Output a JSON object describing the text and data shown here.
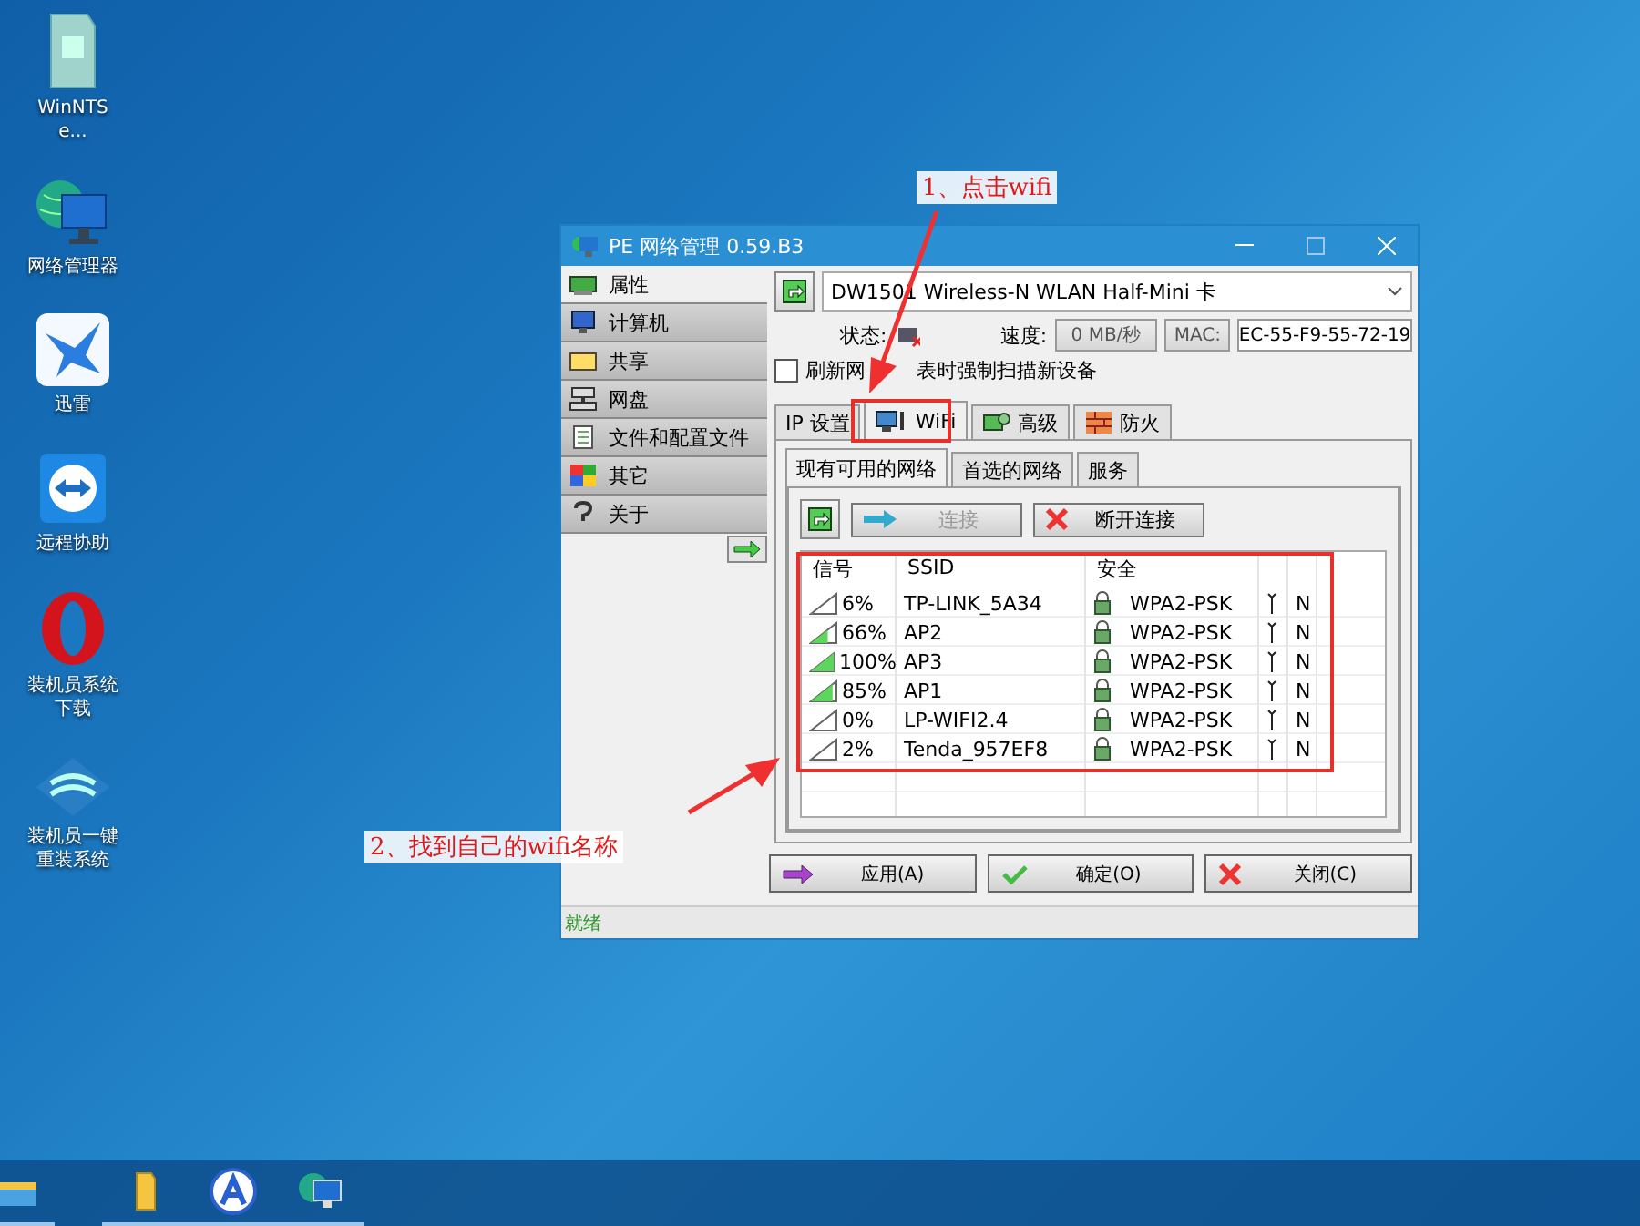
{
  "desktop_icons": [
    {
      "label": "WinNTSe..."
    },
    {
      "label": "网络管理器"
    },
    {
      "label": "迅雷"
    },
    {
      "label": "远程协助"
    },
    {
      "label": "装机员系统下载"
    },
    {
      "label": "装机员一键重装系统"
    }
  ],
  "window": {
    "title": "PE 网络管理 0.59.B3"
  },
  "sidebar": {
    "items": [
      {
        "label": "属性",
        "selected": true
      },
      {
        "label": "计算机",
        "selected": false
      },
      {
        "label": "共享",
        "selected": false
      },
      {
        "label": "网盘",
        "selected": false
      },
      {
        "label": "文件和配置文件",
        "selected": false
      },
      {
        "label": "其它",
        "selected": false
      },
      {
        "label": "关于",
        "selected": false
      }
    ]
  },
  "adapter": {
    "value": "DW1501 Wireless-N WLAN Half-Mini 卡"
  },
  "status": {
    "state_label": "状态:",
    "speed_label": "速度:",
    "speed": "0 MB/秒",
    "mac_label": "MAC:",
    "mac": "EC-55-F9-55-72-19"
  },
  "force_scan": {
    "label_parts": [
      "刷新网",
      "表时强制扫描新设备"
    ],
    "checked": false
  },
  "tabs": [
    {
      "label": "IP 设置",
      "selected": false
    },
    {
      "label": "WiFi",
      "selected": true
    },
    {
      "label": "高级",
      "selected": false
    },
    {
      "label": "防火",
      "selected": false
    }
  ],
  "subtabs": [
    {
      "label": "现有可用的网络",
      "selected": true
    },
    {
      "label": "首选的网络",
      "selected": false
    },
    {
      "label": "服务",
      "selected": false
    }
  ],
  "actions": [
    {
      "label": "连接",
      "disabled": true
    },
    {
      "label": "断开连接",
      "disabled": false
    }
  ],
  "table": {
    "columns": [
      "信号",
      "SSID",
      "安全"
    ],
    "rows": [
      {
        "level": 0.06,
        "signal": "6%",
        "ssid": "TP-LINK_5A34",
        "security": "WPA2-PSK",
        "mode": "N"
      },
      {
        "level": 0.66,
        "signal": "66%",
        "ssid": "AP2",
        "security": "WPA2-PSK",
        "mode": "N"
      },
      {
        "level": 1,
        "signal": "100%",
        "ssid": "AP3",
        "security": "WPA2-PSK",
        "mode": "N"
      },
      {
        "level": 0.85,
        "signal": "85%",
        "ssid": "AP1",
        "security": "WPA2-PSK",
        "mode": "N"
      },
      {
        "level": 0,
        "signal": "0%",
        "ssid": "LP-WIFI2.4",
        "security": "WPA2-PSK",
        "mode": "N"
      },
      {
        "level": 0.02,
        "signal": "2%",
        "ssid": "Tenda_957EF8",
        "security": "WPA2-PSK",
        "mode": "N"
      }
    ]
  },
  "buttons": [
    {
      "label": "应用(A)"
    },
    {
      "label": "确定(O)"
    },
    {
      "label": "关闭(C)"
    }
  ],
  "status_bar": "就绪",
  "annotations": [
    {
      "text": "1、点击wifi"
    },
    {
      "text": "2、找到自己的wifi名称"
    }
  ]
}
